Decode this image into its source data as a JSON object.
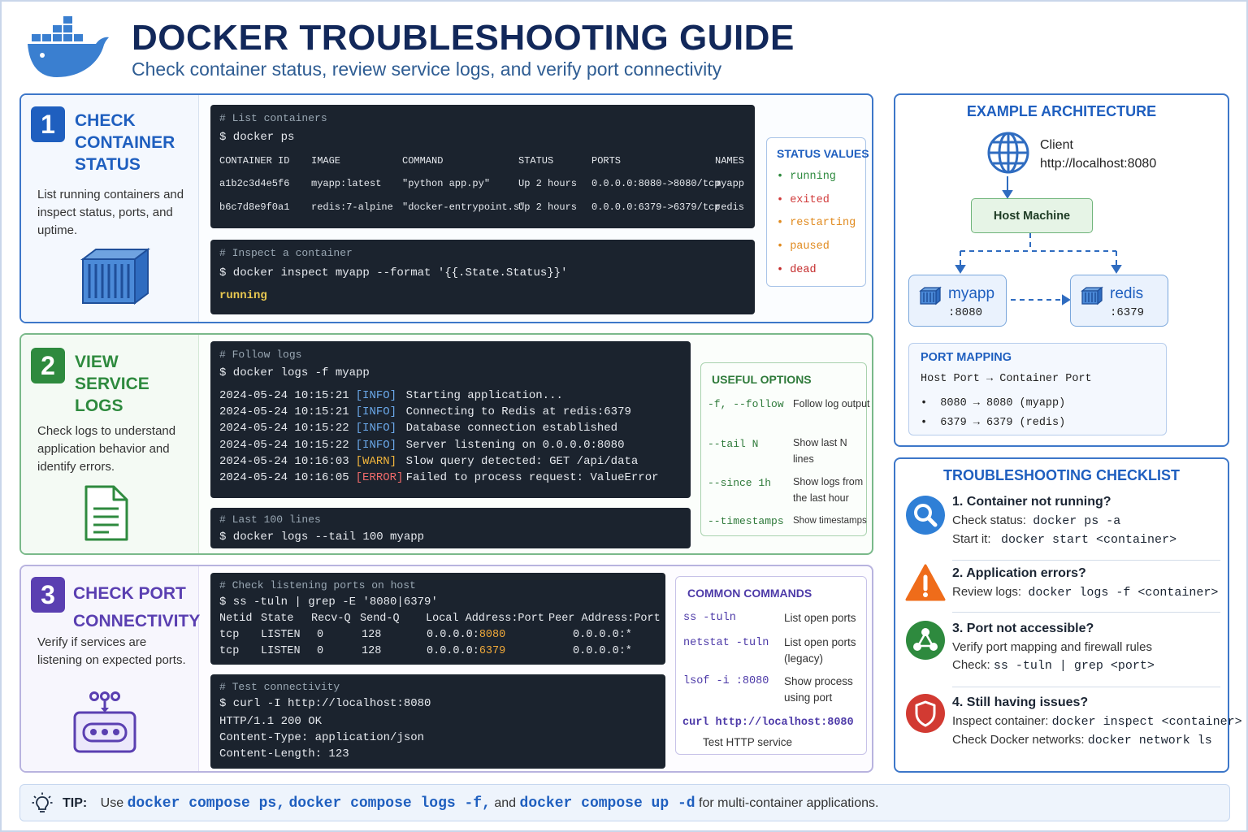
{
  "header": {
    "title": "DOCKER TROUBLESHOOTING GUIDE",
    "subtitle": "Check container status, review service logs, and verify port connectivity"
  },
  "colors": {
    "primary": "#1f5fbf",
    "section2": "#2e8a3e",
    "section3": "#5a3fb1",
    "terminal_bg": "#1b232e"
  },
  "section1": {
    "number": "1",
    "title": "CHECK CONTAINER STATUS",
    "description": "List running containers and inspect status, ports, and uptime.",
    "icon": "shipping-container-icon",
    "term1": {
      "comment": "# List containers",
      "command": "$ docker ps",
      "headers": [
        "CONTAINER ID",
        "IMAGE",
        "COMMAND",
        "STATUS",
        "PORTS",
        "NAMES"
      ],
      "rows": [
        [
          "a1b2c3d4e5f6",
          "myapp:latest",
          "\"python app.py\"",
          "Up 2 hours",
          "0.0.0.0:8080->8080/tcp",
          "myapp"
        ],
        [
          "b6c7d8e9f0a1",
          "redis:7-alpine",
          "\"docker-entrypoint.s\"",
          "Up 2 hours",
          "0.0.0.0:6379->6379/tcp",
          "redis"
        ]
      ]
    },
    "term2": {
      "comment": "# Inspect a container",
      "command": "$ docker inspect myapp --format '{{.State.Status}}'",
      "output": "running"
    },
    "status_box": {
      "title": "STATUS VALUES",
      "items": [
        "running",
        "exited",
        "restarting",
        "paused",
        "dead"
      ],
      "item_colors": [
        "#2e8a3e",
        "#d13b3b",
        "#e08a1e",
        "#e08a1e",
        "#c42b2b"
      ]
    }
  },
  "section2": {
    "number": "2",
    "title": "VIEW SERVICE LOGS",
    "description": "Check logs to understand application behavior and identify errors.",
    "icon": "document-icon",
    "term1": {
      "comment": "# Follow logs",
      "command": "$ docker logs -f myapp",
      "logs": [
        {
          "ts": "2024-05-24 10:15:21",
          "level": "[INFO]",
          "kind": "info",
          "msg": "Starting application..."
        },
        {
          "ts": "2024-05-24 10:15:21",
          "level": "[INFO]",
          "kind": "info",
          "msg": "Connecting to Redis at redis:6379"
        },
        {
          "ts": "2024-05-24 10:15:22",
          "level": "[INFO]",
          "kind": "info",
          "msg": "Database connection established"
        },
        {
          "ts": "2024-05-24 10:15:22",
          "level": "[INFO]",
          "kind": "info",
          "msg": "Server listening on 0.0.0.0:8080"
        },
        {
          "ts": "2024-05-24 10:16:03",
          "level": "[WARN]",
          "kind": "warn",
          "msg": "Slow query detected: GET /api/data"
        },
        {
          "ts": "2024-05-24 10:16:05",
          "level": "[ERROR]",
          "kind": "err",
          "msg": "Failed to process request: ValueError"
        }
      ]
    },
    "term2": {
      "comment": "# Last 100 lines",
      "command": "$ docker logs --tail 100 myapp"
    },
    "options_box": {
      "title": "USEFUL OPTIONS",
      "items": [
        {
          "flag": "-f, --follow",
          "desc": "Follow log output"
        },
        {
          "flag": "--tail N",
          "desc": "Show last N lines"
        },
        {
          "flag": "--since 1h",
          "desc": "Show logs from the last hour"
        },
        {
          "flag": "--timestamps",
          "desc": "Show timestamps"
        }
      ]
    }
  },
  "section3": {
    "number": "3",
    "title": "CHECK PORT CONNECTIVITY",
    "description": "Verify if services are listening on expected ports.",
    "icon": "network-port-icon",
    "term1": {
      "comment": "# Check listening ports on host",
      "command": "$ ss -tuln | grep -E '8080|6379'",
      "headers": [
        "Netid",
        "State",
        "Recv-Q",
        "Send-Q",
        "Local Address:Port",
        "Peer Address:Port"
      ],
      "rows": [
        {
          "netid": "tcp",
          "state": "LISTEN",
          "recv": "0",
          "send": "128",
          "addr": "0.0.0.0:",
          "port": "8080",
          "peer": "0.0.0.0:*"
        },
        {
          "netid": "tcp",
          "state": "LISTEN",
          "recv": "0",
          "send": "128",
          "addr": "0.0.0.0:",
          "port": "6379",
          "peer": "0.0.0.0:*"
        }
      ]
    },
    "term2": {
      "comment": "# Test connectivity",
      "command": "$ curl -I http://localhost:8080",
      "output": [
        "HTTP/1.1 200 OK",
        "Content-Type: application/json",
        "Content-Length: 123"
      ]
    },
    "commands_box": {
      "title": "COMMON COMMANDS",
      "items": [
        {
          "cmd": "ss -tuln",
          "desc": "List open ports"
        },
        {
          "cmd": "netstat -tuln",
          "desc": "List open ports (legacy)"
        },
        {
          "cmd": "lsof -i :8080",
          "desc": "Show process using port"
        }
      ],
      "curl_cmd": "curl http://localhost:8080",
      "curl_desc": "Test HTTP service"
    }
  },
  "architecture": {
    "title": "EXAMPLE ARCHITECTURE",
    "client_label": "Client",
    "client_url": "http://localhost:8080",
    "host_label": "Host Machine",
    "services": [
      {
        "name": "myapp",
        "port": ":8080"
      },
      {
        "name": "redis",
        "port": ":6379"
      }
    ],
    "port_mapping": {
      "title": "PORT MAPPING",
      "header": "Host Port → Container Port",
      "rows": [
        "•  8080 → 8080 (myapp)",
        "•  6379 → 6379 (redis)"
      ]
    }
  },
  "checklist": {
    "title": "TROUBLESHOOTING CHECKLIST",
    "items": [
      {
        "icon": "magnifier-icon",
        "heading": "1. Container not running?",
        "lines": [
          [
            "Check status:",
            "docker ps -a"
          ],
          [
            "Start it:",
            "docker start <container>"
          ]
        ]
      },
      {
        "icon": "warning-icon",
        "heading": "2. Application errors?",
        "lines": [
          [
            "Review logs:",
            "docker logs -f <container>"
          ]
        ]
      },
      {
        "icon": "network-icon",
        "heading": "3. Port not accessible?",
        "lines": [
          [
            "Verify port mapping and firewall rules",
            ""
          ],
          [
            "Check:",
            "ss -tuln | grep <port>"
          ]
        ]
      },
      {
        "icon": "shield-icon",
        "heading": "4. Still having issues?",
        "lines": [
          [
            "Inspect container:",
            "docker inspect <container>"
          ],
          [
            "Check Docker networks:",
            "docker network ls"
          ]
        ]
      }
    ]
  },
  "tip": {
    "label": "TIP:",
    "pre": "Use",
    "cmd1": "docker compose ps,",
    "cmd2": "docker compose logs -f,",
    "and": "and",
    "cmd3": "docker compose up -d",
    "post": "for multi-container applications."
  }
}
